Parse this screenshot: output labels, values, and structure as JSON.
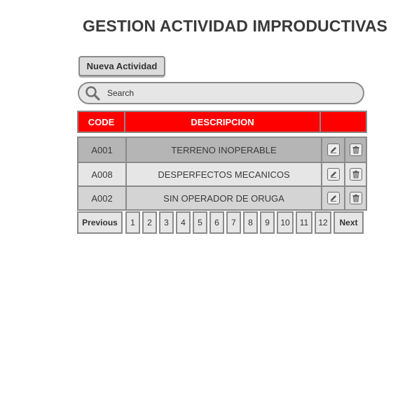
{
  "page": {
    "title": "GESTION ACTIVIDAD IMPRODUCTIVAS"
  },
  "toolbar": {
    "new_activity_label": "Nueva Actividad"
  },
  "search": {
    "placeholder": "Search",
    "value": ""
  },
  "table": {
    "columns": [
      "CODE",
      "DESCRIPCION",
      ""
    ],
    "header_color": "#ff0000",
    "rows": [
      {
        "code": "A001",
        "description": "TERRENO INOPERABLE"
      },
      {
        "code": "A008",
        "description": "DESPERFECTOS MECANICOS"
      },
      {
        "code": "A002",
        "description": "SIN OPERADOR DE ORUGA"
      }
    ],
    "row_icons": [
      "pencil-icon",
      "trash-icon"
    ]
  },
  "pagination": {
    "previous_label": "Previous",
    "next_label": "Next",
    "pages": [
      "1",
      "2",
      "3",
      "4",
      "5",
      "6",
      "7",
      "8",
      "9",
      "10",
      "11",
      "12"
    ]
  }
}
